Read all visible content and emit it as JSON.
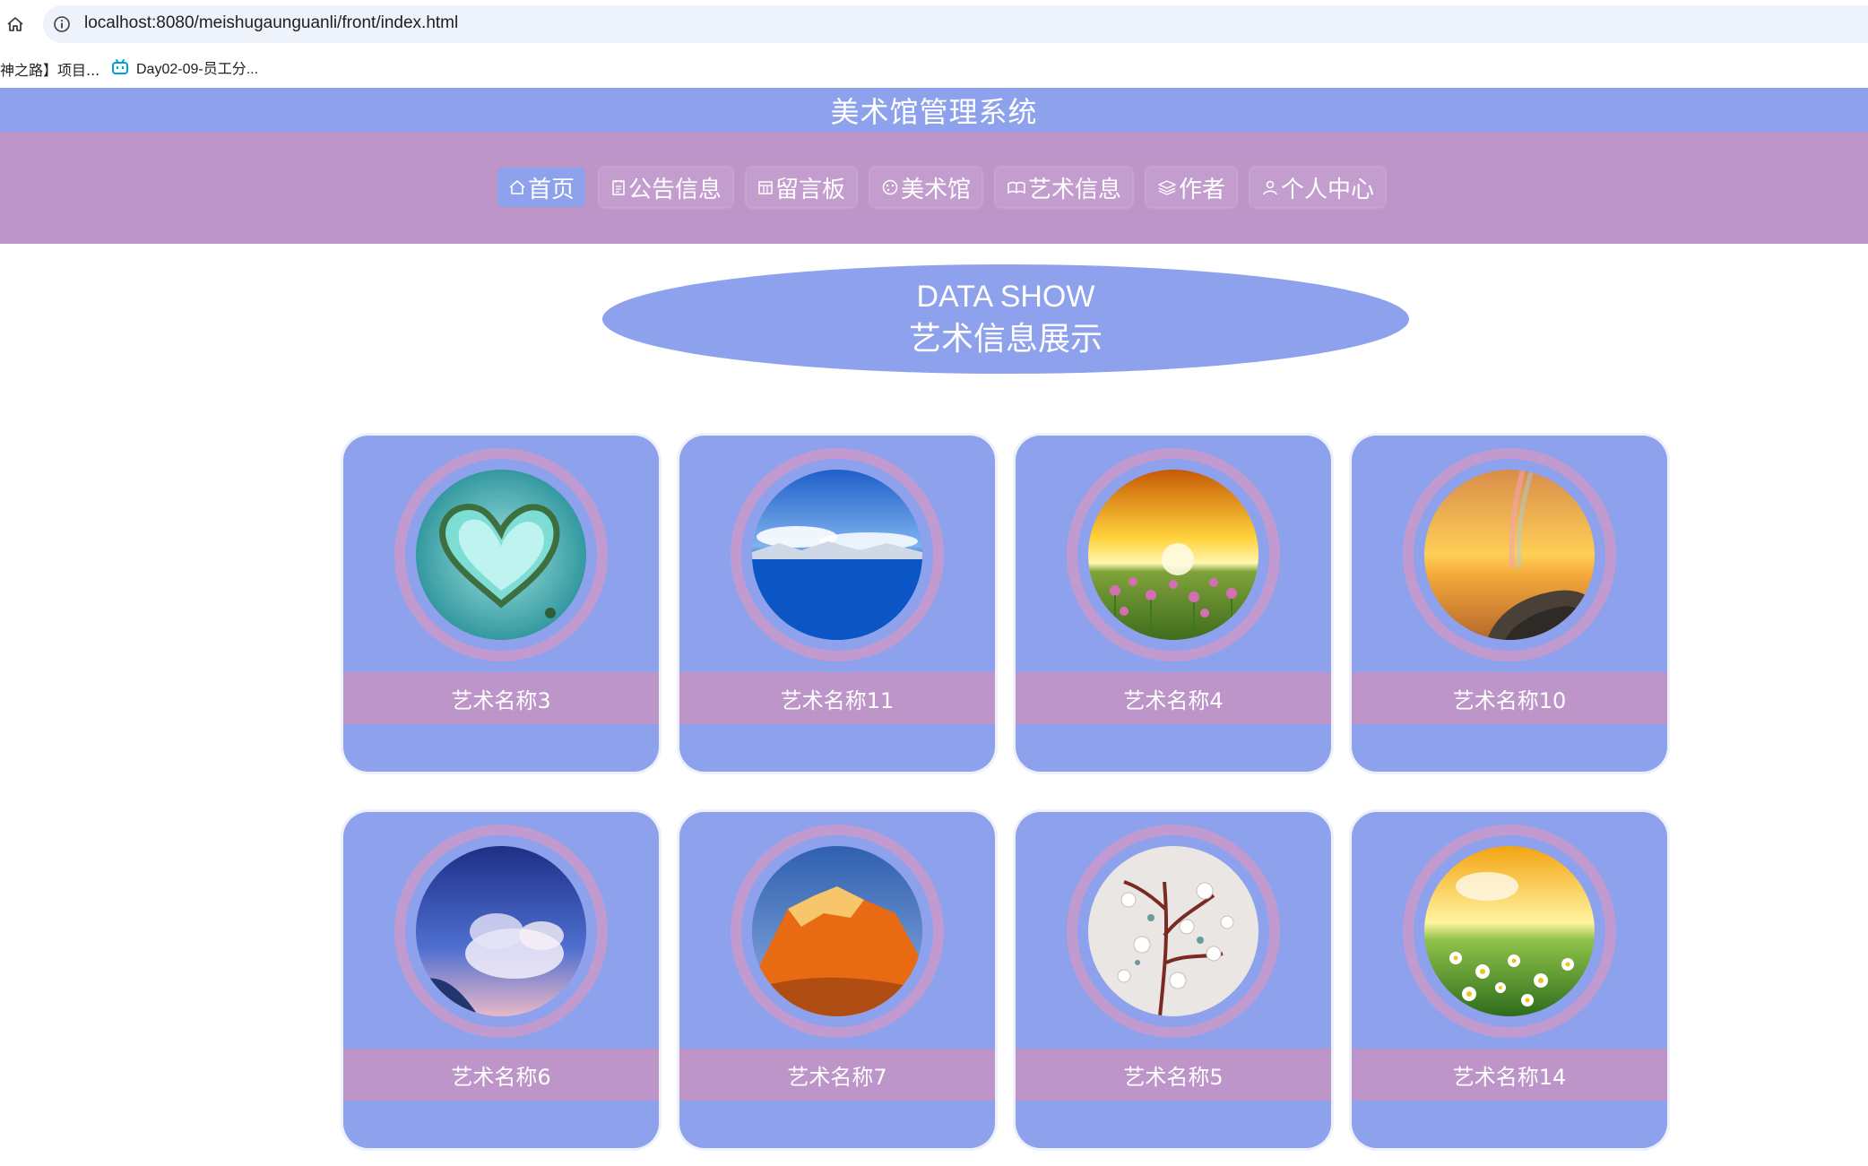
{
  "browser": {
    "url": "localhost:8080/meishugaunguanli/front/index.html",
    "bookmarks": [
      {
        "label": "神之路】项目..."
      },
      {
        "label": "Day02-09-员工分..."
      }
    ]
  },
  "header": {
    "site_title": "美术馆管理系统"
  },
  "nav": {
    "items": [
      {
        "label": "首页",
        "icon": "home-icon",
        "active": true
      },
      {
        "label": "公告信息",
        "icon": "notice-icon",
        "active": false
      },
      {
        "label": "留言板",
        "icon": "message-icon",
        "active": false
      },
      {
        "label": "美术馆",
        "icon": "palette-icon",
        "active": false
      },
      {
        "label": "艺术信息",
        "icon": "book-icon",
        "active": false
      },
      {
        "label": "作者",
        "icon": "layers-icon",
        "active": false
      },
      {
        "label": "个人中心",
        "icon": "user-icon",
        "active": false
      }
    ]
  },
  "section": {
    "title_en": "DATA SHOW",
    "title_cn": "艺术信息展示"
  },
  "cards": [
    {
      "name": "艺术名称3",
      "image": "heart-island"
    },
    {
      "name": "艺术名称11",
      "image": "ocean-sky"
    },
    {
      "name": "艺术名称4",
      "image": "sunset-flowers"
    },
    {
      "name": "艺术名称10",
      "image": "rainbow-coast"
    },
    {
      "name": "艺术名称6",
      "image": "cloud-sky"
    },
    {
      "name": "艺术名称7",
      "image": "red-mountain"
    },
    {
      "name": "艺术名称5",
      "image": "white-blossom"
    },
    {
      "name": "艺术名称14",
      "image": "daisy-field"
    }
  ],
  "colors": {
    "primary": "#8da1ec",
    "secondary": "#bd95c9",
    "ring": "#c19ad0"
  }
}
